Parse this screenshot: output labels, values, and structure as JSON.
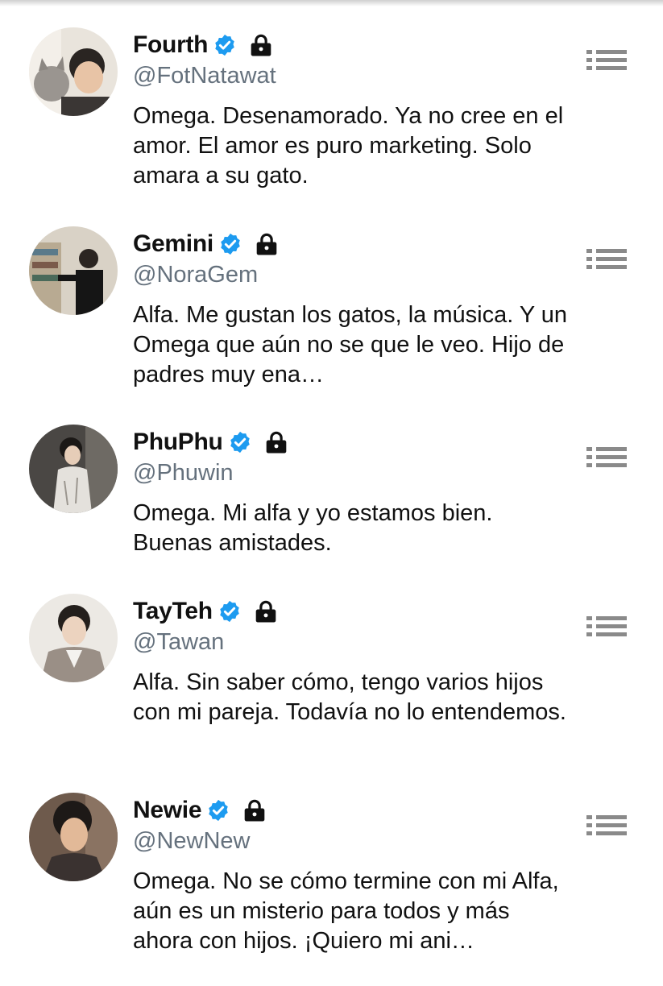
{
  "accounts": [
    {
      "name": "Fourth",
      "handle": "@FotNatawat",
      "bio": "Omega. Desenamorado. Ya no cree en el amor. El amor es puro marketing. Solo amara a su gato.",
      "verified": true,
      "protected": true
    },
    {
      "name": "Gemini",
      "handle": "@NoraGem",
      "bio": "Alfa. Me gustan los gatos, la música. Y un Omega que aún no se que le veo. Hijo de padres muy ena…",
      "verified": true,
      "protected": true
    },
    {
      "name": "PhuPhu",
      "handle": "@Phuwin",
      "bio": "Omega. Mi alfa y yo estamos bien. Buenas amistades.",
      "verified": true,
      "protected": true
    },
    {
      "name": "TayTeh",
      "handle": "@Tawan",
      "bio": "Alfa. Sin saber cómo, tengo varios hijos con mi pareja. Todavía no lo entendemos.",
      "verified": true,
      "protected": true
    },
    {
      "name": "Newie",
      "handle": "@NewNew",
      "bio": "Omega. No se cómo termine con mi Alfa, aún es un misterio para todos y más ahora con hijos. ¡Quiero mi ani…",
      "verified": true,
      "protected": true
    }
  ],
  "icons": {
    "verified": "verified-badge-icon",
    "protected": "lock-icon",
    "menu": "list-menu-icon"
  },
  "colors": {
    "verified_blue": "#1d9bf0",
    "handle_gray": "#65717d",
    "menu_gray": "#8a8a8a",
    "text": "#111111"
  }
}
